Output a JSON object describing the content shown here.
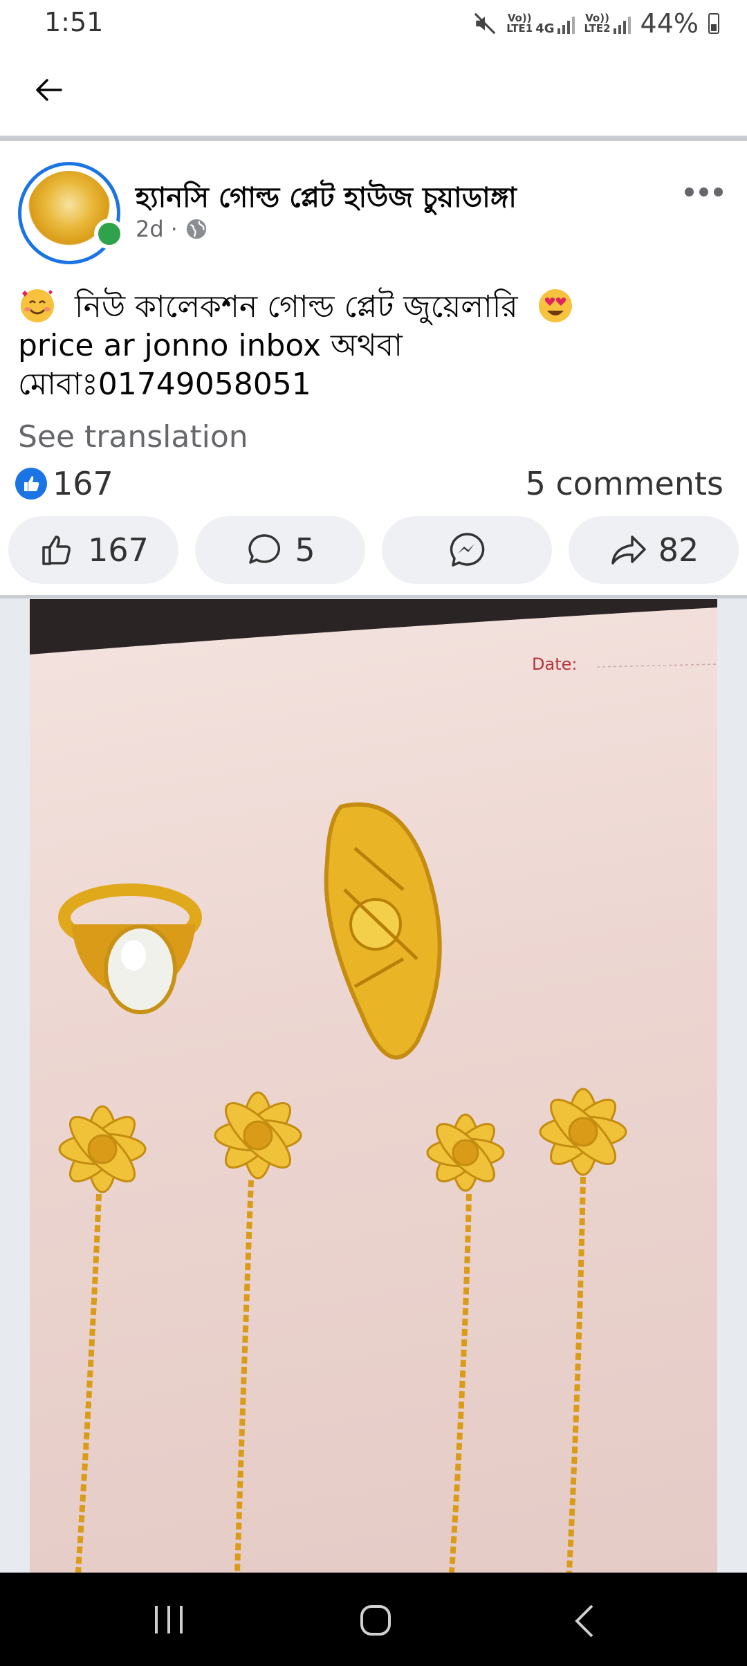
{
  "status_bar": {
    "time": "1:51",
    "sim1_label": "Vo)) LTE1",
    "sim1_net": "4G",
    "sim2_label": "Vo)) LTE2",
    "battery": "44%"
  },
  "post": {
    "page_name": "হ্যানসি গোল্ড প্লেট হাউজ চুয়াডাঙ্গা",
    "time": "2d",
    "separator": "·",
    "text_line1": "নিউ কালেকশন গোল্ড প্লেট জুয়েলারি",
    "text_line2": "price ar jonno inbox অথবা",
    "text_line3": "মোবাঃ01749058051",
    "see_translation": "See translation",
    "reaction_count": "167",
    "comments_text": "5 comments"
  },
  "actions": {
    "like_count": "167",
    "comment_count": "5",
    "share_count": "82"
  },
  "photo": {
    "caption_text": "Date:"
  },
  "colors": {
    "brand_blue": "#1b74e4",
    "online_green": "#31a24c",
    "secondary_text": "#65676b",
    "button_bg": "#eef0f3"
  },
  "icons": [
    "back-arrow-icon",
    "globe-icon",
    "more-icon",
    "like-icon",
    "comment-icon",
    "messenger-icon",
    "share-icon",
    "recents-icon",
    "home-icon",
    "back-icon"
  ]
}
